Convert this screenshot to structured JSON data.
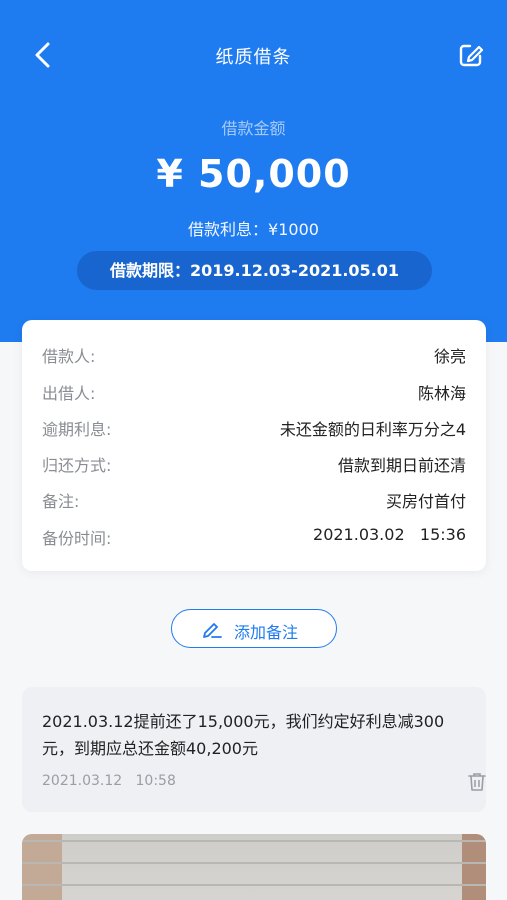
{
  "nav": {
    "title": "纸质借条"
  },
  "summary": {
    "amount_label": "借款金额",
    "amount": "¥ 50,000",
    "interest": "借款利息：¥1000",
    "term": "借款期限：2019.12.03-2021.05.01"
  },
  "details": [
    {
      "key": "借款人:",
      "value": "徐亮"
    },
    {
      "key": "出借人:",
      "value": "陈林海"
    },
    {
      "key": "逾期利息:",
      "value": "未还金额的日利率万分之4"
    },
    {
      "key": "归还方式:",
      "value": "借款到期日前还清"
    },
    {
      "key": "备注:",
      "value": "买房付首付"
    },
    {
      "key": "备份时间:",
      "value": "2021.03.02   15:36"
    }
  ],
  "add_note": {
    "label": "添加备注"
  },
  "note": {
    "text": "2021.03.12提前还了15,000元，我们约定好利息减300元，到期应总还金额40,200元",
    "time": "2021.03.12   10:58"
  },
  "icons": {
    "back": "chevron-left-icon",
    "edit": "edit-icon",
    "pen": "pen-icon",
    "delete": "trash-icon"
  },
  "colors": {
    "primary": "#1f7bf0",
    "term_pill": "#1865cf",
    "page_bg": "#f6f7f9"
  }
}
